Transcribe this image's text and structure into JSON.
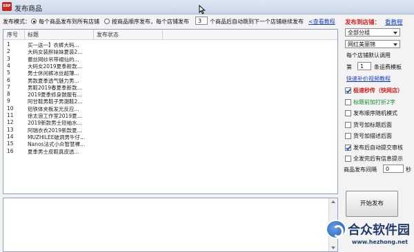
{
  "window": {
    "title": "发布商品",
    "icon_text": "ERP"
  },
  "mode": {
    "label": "发布模式：",
    "option1": "每个商品发布到所有店铺",
    "option2": "按商品顺序发布，每个店铺发布",
    "count": "3",
    "suffix": "个商品后自动跳到下一个店铺继续发布",
    "link": "<查看教程"
  },
  "table": {
    "headers": {
      "no": "序号",
      "title": "标题",
      "status": "发布状态"
    },
    "rows": [
      {
        "no": "1",
        "title": "买一送一】衣裤大码..."
      },
      {
        "no": "2",
        "title": "大码女装胖妹妹夏装2..."
      },
      {
        "no": "3",
        "title": "蕾丝网纱吊带裙仙的..."
      },
      {
        "no": "4",
        "title": "大码女2019夏季新款..."
      },
      {
        "no": "5",
        "title": "男士休闲裤冰丝超薄..."
      },
      {
        "no": "6",
        "title": "男款夏季透气魅力男..."
      },
      {
        "no": "7",
        "title": "男鞋2019春夏季新款..."
      },
      {
        "no": "8",
        "title": "2019夏季修身鼓服有..."
      },
      {
        "no": "9",
        "title": "阿甘鞋男鞋子男潮鞋2..."
      },
      {
        "no": "10",
        "title": "铝铁体夹板发光反应..."
      },
      {
        "no": "11",
        "title": "徐太浪工作室2019夏..."
      },
      {
        "no": "12",
        "title": "2019新款男士短袖水..."
      },
      {
        "no": "13",
        "title": "阿瑞衣衣2019新款夏..."
      },
      {
        "no": "14",
        "title": "MUZHILEE破洞男牛仔..."
      },
      {
        "no": "15",
        "title": "Nanos法式小众智慧裸..."
      },
      {
        "no": "16",
        "title": "夏季男士皮鞋真皮透..."
      }
    ]
  },
  "right": {
    "head_label": "发布到店铺：",
    "head_link": "看教程",
    "group_select": "全部分组",
    "shop_select": "网红美丽锦",
    "default_call_line1": "每个店铺默认调用",
    "default_call_prefix": "第",
    "default_call_value": "1",
    "default_call_suffix": "条运费模板",
    "tutorial_link": "快速补价视频教程",
    "options": [
      {
        "label": "极速秒传（快网店）",
        "checked": true,
        "color": "red"
      },
      {
        "label": "标题前加打折2字",
        "checked": false,
        "color": "green"
      },
      {
        "label": "发布顺序随机模式",
        "checked": false,
        "color": ""
      },
      {
        "label": "货号加标题后面",
        "checked": false,
        "color": ""
      },
      {
        "label": "货号加描述后面",
        "checked": false,
        "color": ""
      },
      {
        "label": "发布后自动提交审核",
        "checked": true,
        "color": ""
      },
      {
        "label": "全发完后有信息提示",
        "checked": false,
        "color": ""
      }
    ],
    "interval_label": "商品发布间隔",
    "interval_value": "0",
    "interval_unit": "秒",
    "publish_button": "开始发布"
  },
  "watermark": {
    "name": "合众软件园",
    "url": "www.hezhong.net"
  }
}
